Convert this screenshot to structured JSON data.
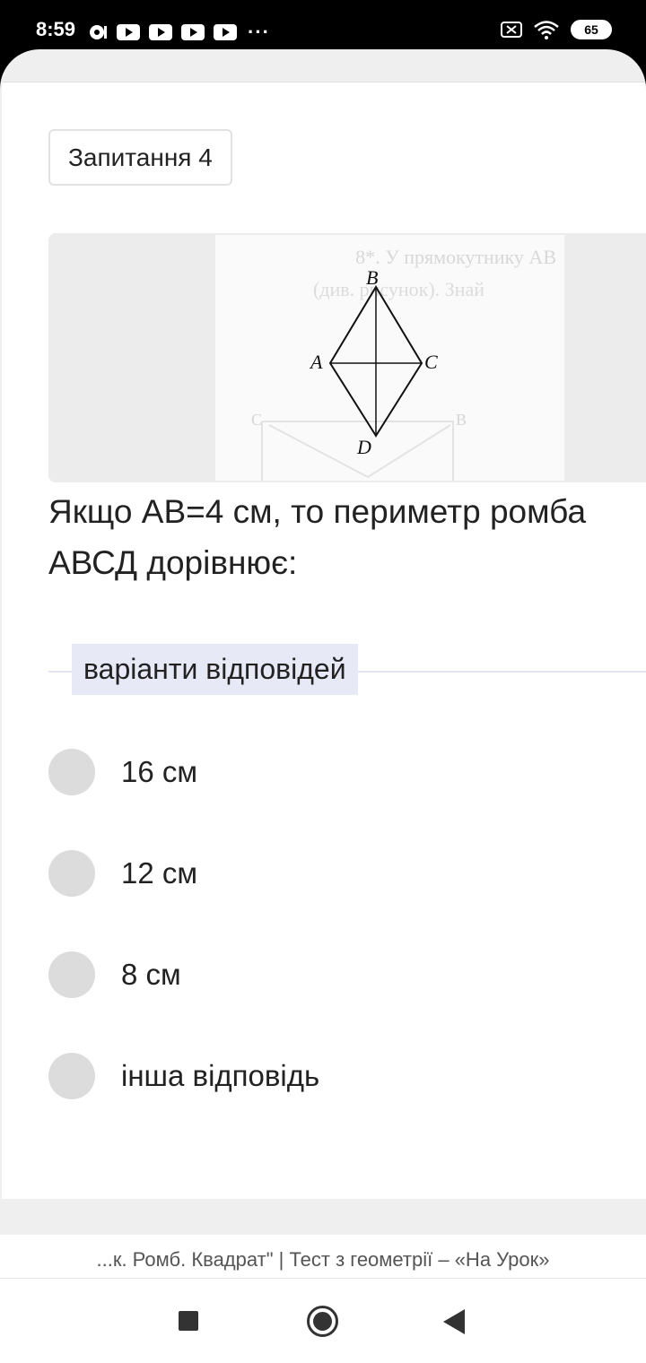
{
  "status": {
    "time": "8:59",
    "battery": "65"
  },
  "question": {
    "badge": "Запитання 4",
    "text": "Якщо АВ=4 см, то периметр ромба АВСД дорівнює:"
  },
  "figure": {
    "labels": {
      "b": "B",
      "a": "A",
      "c": "C",
      "d": "D"
    },
    "faint_text_line1": "8*. У прямокутнику АВ",
    "faint_text_line2": "(див. рисунок). Знай",
    "faint_c": "C",
    "faint_b": "B"
  },
  "answers": {
    "section_label": "варіанти відповідей",
    "options": [
      {
        "label": "16 см"
      },
      {
        "label": "12 см"
      },
      {
        "label": "8 см"
      },
      {
        "label": "інша відповідь"
      }
    ]
  },
  "browser": {
    "url_title": "...к. Ромб. Квадрат\" | Тест з геометрії – «На Урок»"
  }
}
